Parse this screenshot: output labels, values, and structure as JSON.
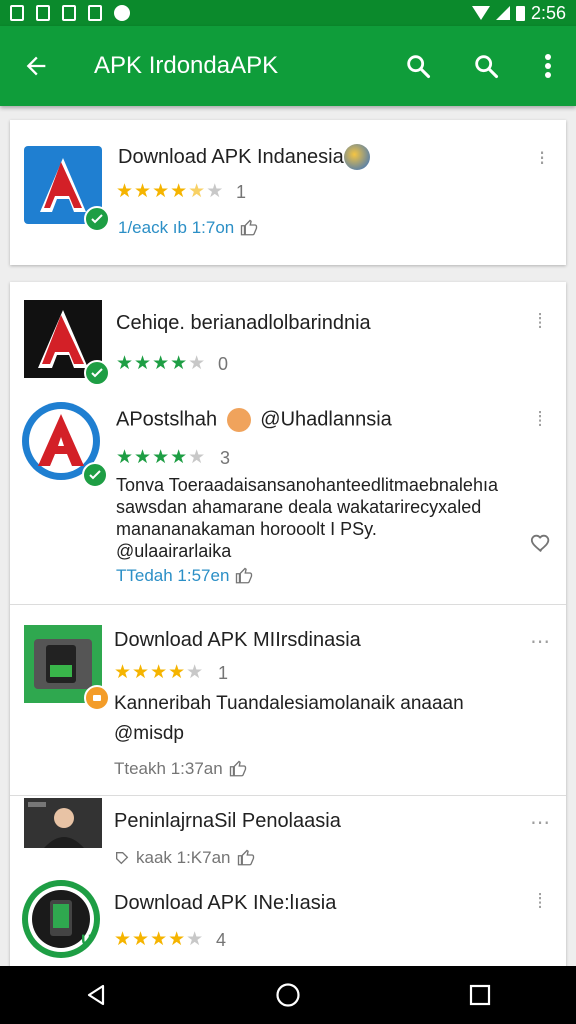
{
  "status_bar": {
    "time": "2:56"
  },
  "app_bar": {
    "title": "APK IrdondaAPK"
  },
  "featured": {
    "name": "Download APK Indanesia",
    "rating_count": "1",
    "meta": "1/eack ıb 1:7on"
  },
  "items": [
    {
      "name": "Cehiqe. berianadlolbarindnia",
      "rating_count": "0"
    },
    {
      "name": "APostslhah",
      "handle": "@Uhadlannsia",
      "rating_count": "3",
      "description": [
        "Tonva Toeraadaisansanohanteedlitmaebnalehıa",
        "sawsdan ahamarane deala wakatarirecyxaled",
        "manananakaman horooolt I PSy.",
        "@ulaairarlaika"
      ],
      "meta": "TTedah 1:57en"
    },
    {
      "name": "Download APK MIIrsdinasia",
      "rating_count": "1",
      "description": [
        "Kanneribah Tuandalesiamolanaik anaaan",
        "@misdp"
      ],
      "meta": "Tteakh 1:37an"
    },
    {
      "name": "PeninlajrnaSil Penolaasia",
      "meta": "kaak 1:K7an"
    },
    {
      "name": "Download APK INe:lıasia",
      "rating_count": "4"
    }
  ],
  "colors": {
    "primary": "#0f9d3a",
    "status": "#0b8a2c",
    "star": "#f5b400",
    "verified": "#1e9e44",
    "link": "#2b8fc6"
  },
  "icons": [
    "back-arrow-icon",
    "search-icon",
    "more-vert-icon",
    "verified-check-icon",
    "like-icon",
    "heart-icon",
    "nav-back-icon",
    "nav-home-icon",
    "nav-recents-icon"
  ]
}
